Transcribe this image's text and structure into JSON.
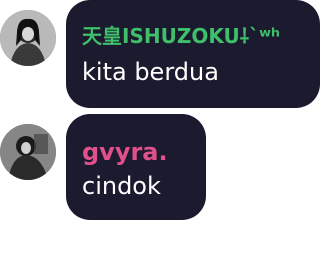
{
  "messages": [
    {
      "username": "天皇ISHUZOKU⸸`ʷʰ",
      "username_color": "#3fbf6a",
      "text": "kita berdua",
      "avatar_icon": "user-avatar"
    },
    {
      "username": "gvyra.",
      "username_color": "#e0508a",
      "text": "cindok",
      "avatar_icon": "user-avatar"
    }
  ]
}
